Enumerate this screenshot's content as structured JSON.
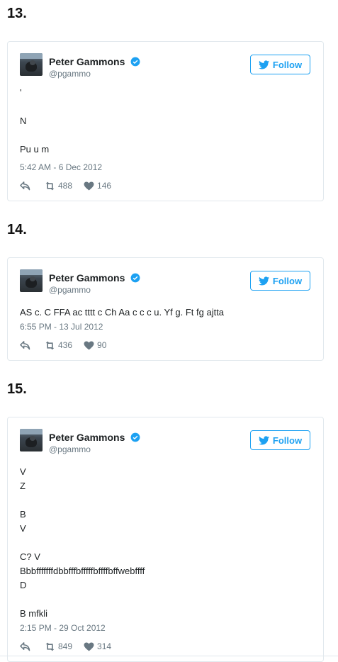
{
  "colors": {
    "accent": "#1da1f2",
    "muted": "#697882",
    "text": "#1c2022",
    "border": "#e1e8ed"
  },
  "sections": [
    {
      "number": "13.",
      "tweet": {
        "name": "Peter Gammons",
        "handle": "@pgammo",
        "follow_label": "Follow",
        "text": "'\n\nN\n\nPu u m",
        "timestamp": "5:42 AM - 6 Dec 2012",
        "retweets": "488",
        "likes": "146"
      }
    },
    {
      "number": "14.",
      "tweet": {
        "name": "Peter Gammons",
        "handle": "@pgammo",
        "follow_label": "Follow",
        "text": "AS c. C FFA ac tttt c Ch Aa c c c u. Yf g. Ft fg ajtta",
        "timestamp": "6:55 PM - 13 Jul 2012",
        "retweets": "436",
        "likes": "90"
      }
    },
    {
      "number": "15.",
      "tweet": {
        "name": "Peter Gammons",
        "handle": "@pgammo",
        "follow_label": "Follow",
        "text": "V\nZ\n\nB\nV\n\nC? V\nBbbfffffffdbbfffbfffffbffffbffwebffff\nD\n\nB mfkli",
        "timestamp": "2:15 PM - 29 Oct 2012",
        "retweets": "849",
        "likes": "314"
      }
    }
  ]
}
